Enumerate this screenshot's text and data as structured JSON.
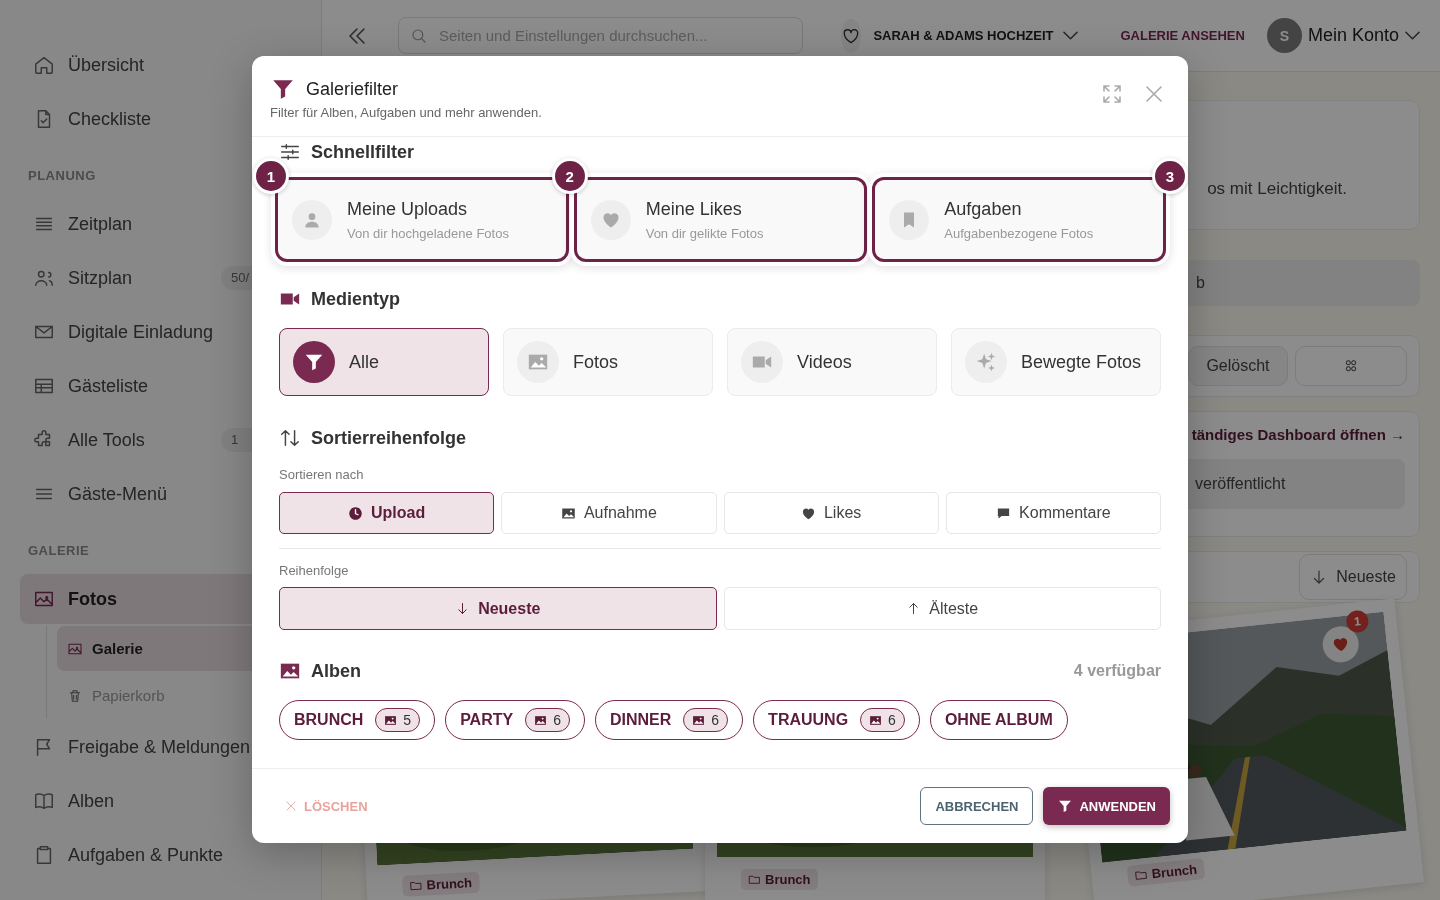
{
  "sidebar": {
    "groups": [
      {
        "items": [
          {
            "label": "Übersicht",
            "selected": false
          },
          {
            "label": "Checkliste",
            "selected": false
          }
        ]
      },
      {
        "heading": "PLANUNG",
        "items": [
          {
            "label": "Zeitplan",
            "selected": false
          },
          {
            "label": "Sitzplan",
            "badge": "50/",
            "selected": false
          },
          {
            "label": "Digitale Einladung",
            "selected": false
          },
          {
            "label": "Gästeliste",
            "selected": false
          },
          {
            "label": "Alle Tools",
            "badge": "1",
            "selected": false
          },
          {
            "label": "Gäste-Menü",
            "selected": false
          }
        ]
      },
      {
        "heading": "GALERIE",
        "items": [
          {
            "label": "Fotos",
            "selected": true,
            "children": [
              {
                "label": "Galerie",
                "selected": true
              },
              {
                "label": "Papierkorb",
                "selected": false
              }
            ]
          },
          {
            "label": "Freigabe & Meldungen",
            "selected": false
          },
          {
            "label": "Alben",
            "selected": false
          },
          {
            "label": "Aufgaben & Punkte",
            "selected": false
          }
        ]
      }
    ]
  },
  "topbar": {
    "search": {
      "placeholder": "Seiten und Einstellungen durchsuchen..."
    },
    "event": "SARAH & ADAMS HOCHZEIT",
    "view_gallery": "GALERIE ANSEHEN",
    "avatar": "S",
    "account": "Mein Konto"
  },
  "background": {
    "intro": "os mit Leichtigkeit.",
    "field": "b",
    "filter_button": "Gelöscht",
    "dashboard_link": "tändiges Dashboard öffnen →",
    "status": "veröffentlicht",
    "sort_button": "Neueste",
    "photos": [
      {
        "tag": "Brunch"
      },
      {
        "tag": "Brunch"
      },
      {
        "tag": "Brunch",
        "likes": "1"
      }
    ]
  },
  "dialog": {
    "title": "Galeriefilter",
    "subtitle": "Filter für Alben, Aufgaben und mehr anwenden.",
    "quick_filters": {
      "heading": "Schnellfilter",
      "items": [
        {
          "step": "1",
          "step_right": false,
          "title": "Meine Uploads",
          "subtitle": "Von dir hochgeladene Fotos",
          "highlighted": true
        },
        {
          "step": "2",
          "step_right": false,
          "title": "Meine Likes",
          "subtitle": "Von dir gelikte Fotos",
          "highlighted": true
        },
        {
          "step": "3",
          "step_right": true,
          "title": "Aufgaben",
          "subtitle": "Aufgabenbezogene Fotos",
          "highlighted": true
        }
      ]
    },
    "media_type": {
      "heading": "Medientyp",
      "options": [
        {
          "label": "Alle",
          "selected": true
        },
        {
          "label": "Fotos",
          "selected": false
        },
        {
          "label": "Videos",
          "selected": false
        },
        {
          "label": "Bewegte Fotos",
          "selected": false
        }
      ]
    },
    "sort": {
      "heading": "Sortierreihenfolge",
      "by_label": "Sortieren nach",
      "by": [
        {
          "label": "Upload",
          "selected": true
        },
        {
          "label": "Aufnahme",
          "selected": false
        },
        {
          "label": "Likes",
          "selected": false
        },
        {
          "label": "Kommentare",
          "selected": false
        }
      ],
      "order_label": "Reihenfolge",
      "order": [
        {
          "label": "Neueste",
          "selected": true
        },
        {
          "label": "Älteste",
          "selected": false
        }
      ]
    },
    "albums": {
      "heading": "Alben",
      "available": "4 verfügbar",
      "items": [
        {
          "label": "BRUNCH",
          "count": "5",
          "selected": false
        },
        {
          "label": "PARTY",
          "count": "6",
          "selected": false
        },
        {
          "label": "DINNER",
          "count": "6",
          "selected": false
        },
        {
          "label": "TRAUUNG",
          "count": "6",
          "selected": false
        },
        {
          "label": "OHNE ALBUM",
          "selected": false
        }
      ]
    },
    "clear": {
      "label": "LÖSCHEN",
      "disabled": true
    },
    "cancel": "ABBRECHEN",
    "apply": "ANWENDEN"
  }
}
